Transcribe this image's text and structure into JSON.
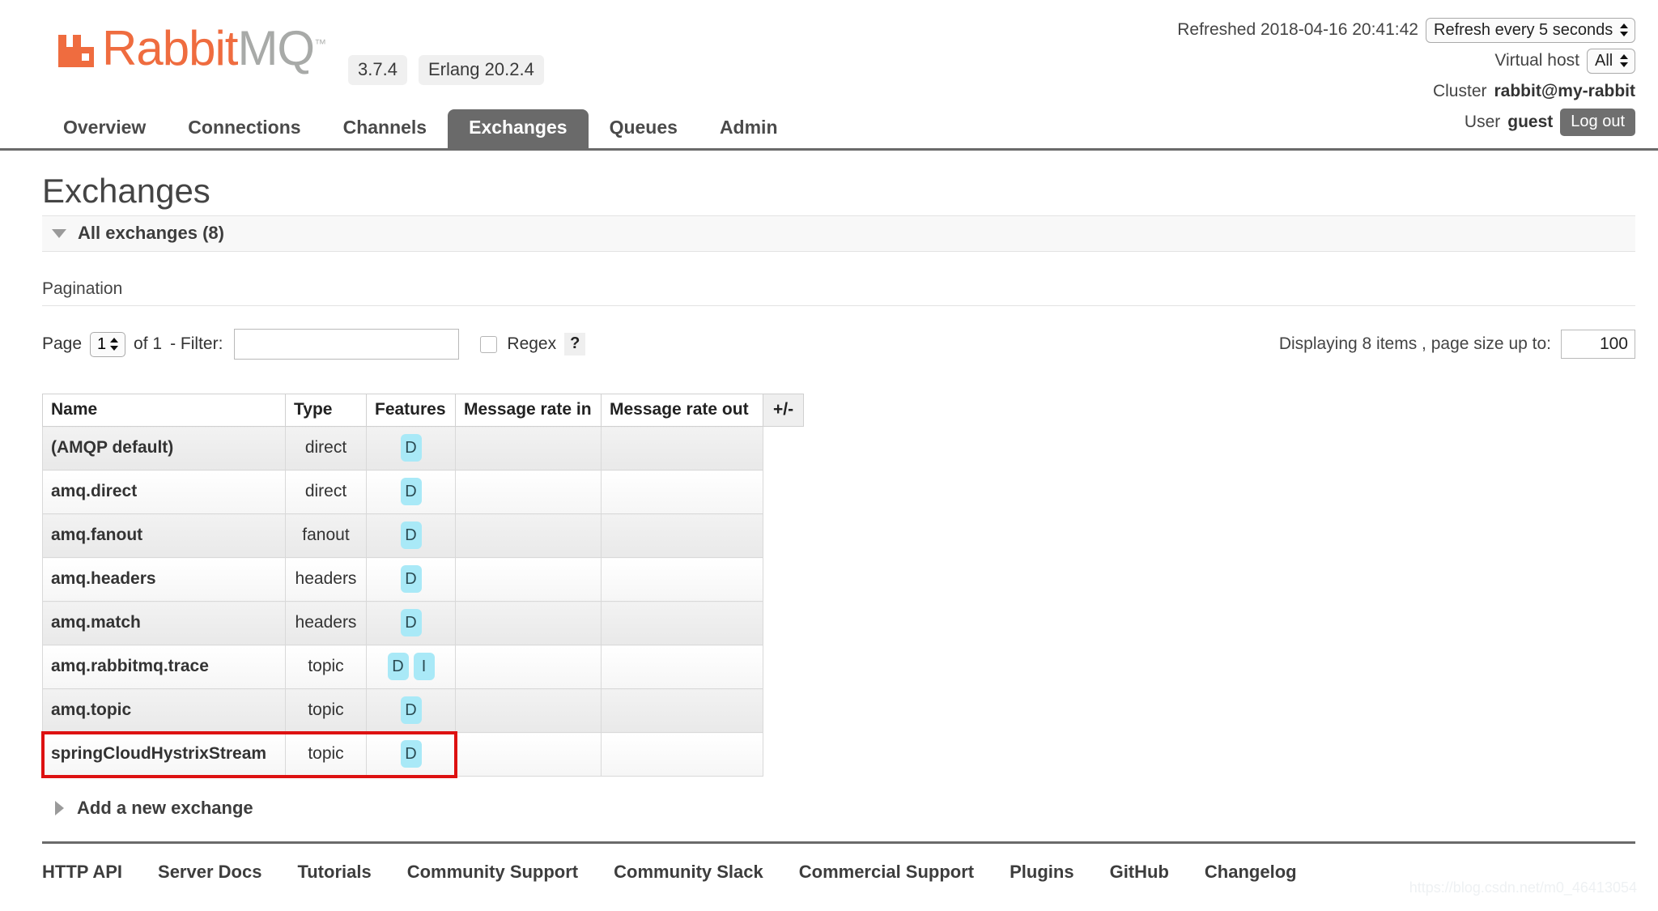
{
  "brand": {
    "name_part1": "Rabbit",
    "name_part2": "MQ",
    "trademark": "™",
    "version": "3.7.4",
    "erlang_version": "Erlang 20.2.4"
  },
  "header": {
    "refreshed_text": "Refreshed 2018-04-16 20:41:42",
    "refresh_interval": "Refresh every 5 seconds",
    "vhost_label": "Virtual host",
    "vhost_value": "All",
    "cluster_label": "Cluster",
    "cluster_value": "rabbit@my-rabbit",
    "user_label": "User",
    "user_value": "guest",
    "logout_label": "Log out"
  },
  "nav": {
    "tabs": [
      {
        "label": "Overview",
        "active": false
      },
      {
        "label": "Connections",
        "active": false
      },
      {
        "label": "Channels",
        "active": false
      },
      {
        "label": "Exchanges",
        "active": true
      },
      {
        "label": "Queues",
        "active": false
      },
      {
        "label": "Admin",
        "active": false
      }
    ]
  },
  "main": {
    "page_title": "Exchanges",
    "section_header": "All exchanges (8)",
    "pagination_label": "Pagination",
    "page_label": "Page",
    "page_value": "1",
    "of_label": "of 1",
    "filter_label": "- Filter:",
    "filter_value": "",
    "filter_placeholder": "",
    "regex_label": "Regex",
    "help_label": "?",
    "displaying_text": "Displaying 8 items , page size up to:",
    "page_size_value": "100",
    "add_exchange_label": "Add a new exchange"
  },
  "table": {
    "columns": [
      "Name",
      "Type",
      "Features",
      "Message rate in",
      "Message rate out"
    ],
    "plusminus_label": "+/-",
    "rows": [
      {
        "name": "(AMQP default)",
        "type": "direct",
        "features": [
          "D"
        ],
        "rate_in": "",
        "rate_out": "",
        "highlighted": false
      },
      {
        "name": "amq.direct",
        "type": "direct",
        "features": [
          "D"
        ],
        "rate_in": "",
        "rate_out": "",
        "highlighted": false
      },
      {
        "name": "amq.fanout",
        "type": "fanout",
        "features": [
          "D"
        ],
        "rate_in": "",
        "rate_out": "",
        "highlighted": false
      },
      {
        "name": "amq.headers",
        "type": "headers",
        "features": [
          "D"
        ],
        "rate_in": "",
        "rate_out": "",
        "highlighted": false
      },
      {
        "name": "amq.match",
        "type": "headers",
        "features": [
          "D"
        ],
        "rate_in": "",
        "rate_out": "",
        "highlighted": false
      },
      {
        "name": "amq.rabbitmq.trace",
        "type": "topic",
        "features": [
          "D",
          "I"
        ],
        "rate_in": "",
        "rate_out": "",
        "highlighted": false
      },
      {
        "name": "amq.topic",
        "type": "topic",
        "features": [
          "D"
        ],
        "rate_in": "",
        "rate_out": "",
        "highlighted": false
      },
      {
        "name": "springCloudHystrixStream",
        "type": "topic",
        "features": [
          "D"
        ],
        "rate_in": "",
        "rate_out": "",
        "highlighted": true
      }
    ]
  },
  "footer": {
    "links": [
      "HTTP API",
      "Server Docs",
      "Tutorials",
      "Community Support",
      "Community Slack",
      "Commercial Support",
      "Plugins",
      "GitHub",
      "Changelog"
    ]
  },
  "watermark": "https://blog.csdn.net/m0_46413054",
  "colors": {
    "brand_orange": "#ef6c3f",
    "brand_gray": "#a8aaa8",
    "tab_active_bg": "#6a6a6a",
    "feature_badge_bg": "#a9e9f7",
    "annotation_red": "#dd1111"
  }
}
